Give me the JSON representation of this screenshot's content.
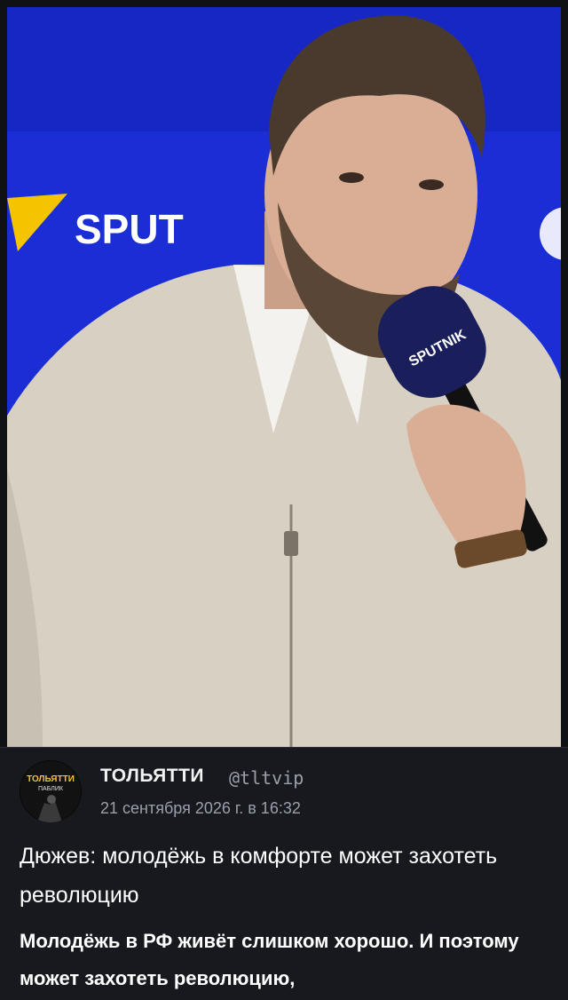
{
  "photo": {
    "description_icon": "press-photo",
    "banner_text": "SPUT",
    "mic_text": "SPUTNIK",
    "colors": {
      "backdrop": "#1b2ed6",
      "jacket": "#d8d0c2",
      "mic": "#1a1f5c"
    }
  },
  "post": {
    "avatar_text": "ТОЛЬЯТТИ",
    "avatar_subtext": "ПАБЛИК",
    "author": "ТОЛЬЯТТИ",
    "handle": "@tltvip",
    "date": "21 сентября 2026 г. в 16:32",
    "title": "Дюжев: молодёжь в комфорте может захотеть революцию",
    "lead": "Молодёжь в РФ живёт слишком хорошо. И поэтому может захотеть революцию,"
  }
}
